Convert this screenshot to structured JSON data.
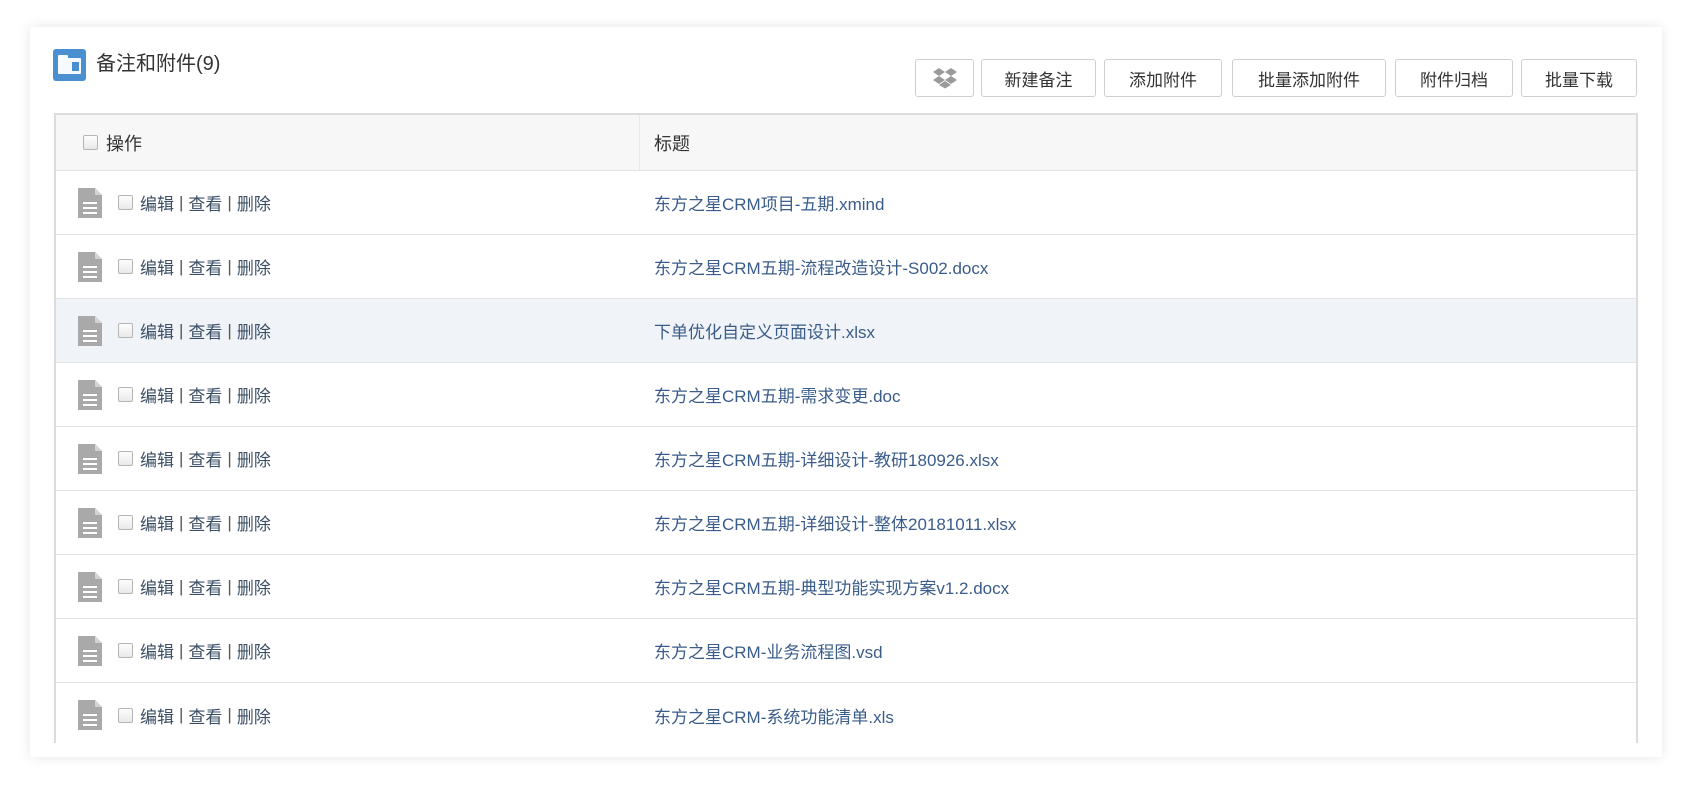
{
  "header": {
    "title": "备注和附件(9)",
    "buttons": {
      "new_note": "新建备注",
      "add_attachment": "添加附件",
      "batch_add_attachment": "批量添加附件",
      "archive_attachment": "附件归档",
      "batch_download": "批量下载"
    },
    "dropbox_icon": "dropbox-icon"
  },
  "table": {
    "columns": {
      "ops": "操作",
      "title": "标题"
    },
    "action_labels": {
      "edit": "编辑",
      "view": "查看",
      "delete": "删除",
      "separator": "|"
    },
    "rows": [
      {
        "title": "东方之星CRM项目-五期.xmind"
      },
      {
        "title": "东方之星CRM五期-流程改造设计-S002.docx"
      },
      {
        "title": "下单优化自定义页面设计.xlsx"
      },
      {
        "title": "东方之星CRM五期-需求变更.doc"
      },
      {
        "title": "东方之星CRM五期-详细设计-教研180926.xlsx"
      },
      {
        "title": "东方之星CRM五期-详细设计-整体20181011.xlsx"
      },
      {
        "title": "东方之星CRM五期-典型功能实现方案v1.2.docx"
      },
      {
        "title": "东方之星CRM-业务流程图.vsd"
      },
      {
        "title": "东方之星CRM-系统功能清单.xls"
      }
    ],
    "highlighted_row": 2
  },
  "colors": {
    "folder_icon": "#4a8fd0",
    "link": "#3a5c8a",
    "row_highlight": "#f0f3f7",
    "doc_icon": "#a9a9a9"
  }
}
